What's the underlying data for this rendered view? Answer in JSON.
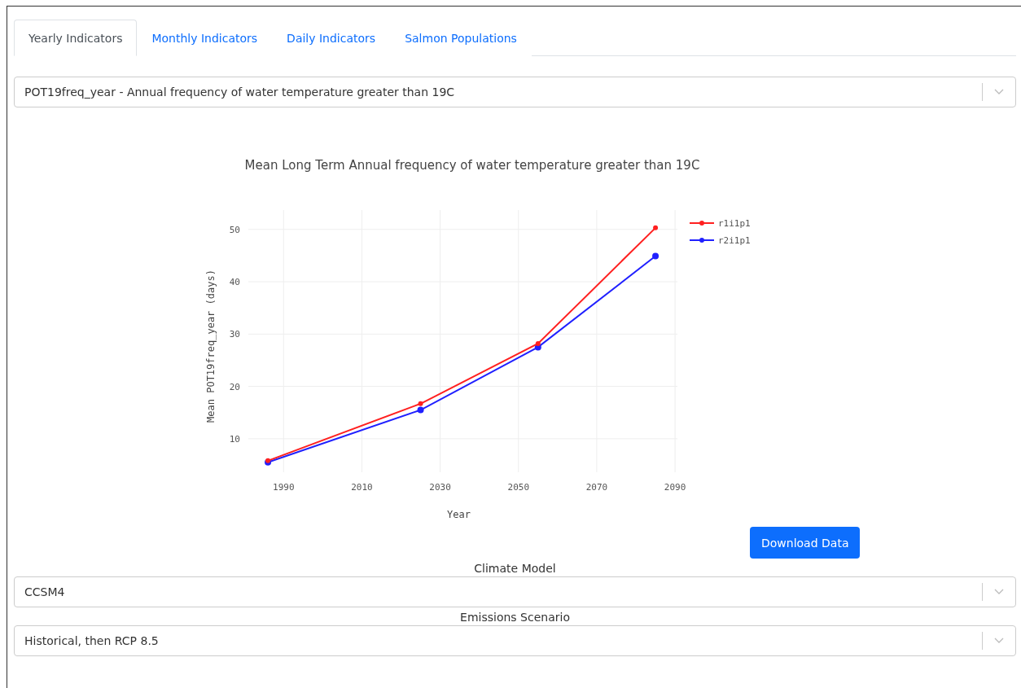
{
  "tabs": [
    {
      "label": "Yearly Indicators",
      "selected": true
    },
    {
      "label": "Monthly Indicators",
      "selected": false
    },
    {
      "label": "Daily Indicators",
      "selected": false
    },
    {
      "label": "Salmon Populations",
      "selected": false
    }
  ],
  "indicator_select": {
    "value": "POT19freq_year - Annual frequency of water temperature greater than 19C"
  },
  "chart": {
    "chart_data": {
      "type": "line",
      "title": "Mean Long Term Annual frequency of water temperature greater than 19C",
      "xlabel": "Year",
      "ylabel": "Mean POT19freq_year (days)",
      "x": [
        1986,
        2025,
        2055,
        2085
      ],
      "xlim": [
        1981,
        2090.6
      ],
      "ylim": [
        3.6,
        53.7
      ],
      "xticks": [
        1990,
        2010,
        2030,
        2050,
        2070,
        2090
      ],
      "yticks": [
        10,
        20,
        30,
        40,
        50
      ],
      "grid": true,
      "legend": true,
      "series": [
        {
          "name": "r1i1p1",
          "color": "#ff2020",
          "marker": "circle",
          "values": [
            5.8,
            16.7,
            28.2,
            50.3
          ]
        },
        {
          "name": "r2i1p1",
          "color": "#2020ff",
          "marker": "circle",
          "values": [
            5.5,
            15.5,
            27.5,
            44.9
          ]
        }
      ]
    }
  },
  "download_button": "Download Data",
  "selects": [
    {
      "label": "Climate Model",
      "value": "CCSM4"
    },
    {
      "label": "Emissions Scenario",
      "value": "Historical, then RCP 8.5"
    }
  ]
}
